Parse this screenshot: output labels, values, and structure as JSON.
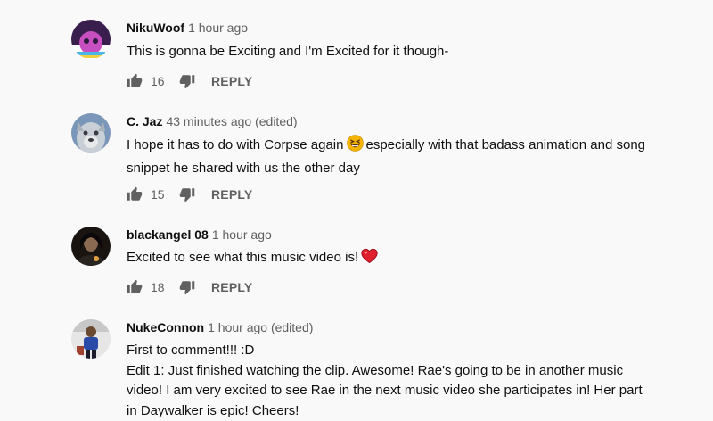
{
  "comments": [
    {
      "author": "NikuWoof",
      "time": "1 hour ago",
      "text": [
        "This is gonna be Exciting and I'm Excited for it though-"
      ],
      "likes": "16",
      "reply_label": "REPLY",
      "avatar_colors": [
        "#2a1a3c",
        "#c84fc0",
        "#ffffff"
      ]
    },
    {
      "author": "C. Jaz",
      "time": "43 minutes ago (edited)",
      "text_before_emoji": "I hope it has to do with Corpse again",
      "emoji": "grinning-squinting-face",
      "text_after_emoji": "especially with that badass animation and song",
      "text_line2": "snippet he shared with us the other day",
      "likes": "15",
      "reply_label": "REPLY",
      "avatar_colors": [
        "#7a96b8",
        "#c9cfd6",
        "#3a3a40"
      ]
    },
    {
      "author": "blackangel 08",
      "time": "1 hour ago",
      "text_before_emoji": "Excited to see what this music video is!",
      "emoji": "red-heart",
      "likes": "18",
      "reply_label": "REPLY",
      "avatar_colors": [
        "#1a1410",
        "#8a6a50",
        "#e0a040"
      ]
    },
    {
      "author": "NukeConnon",
      "time": "1 hour ago (edited)",
      "text": [
        "First to comment!!! :D",
        "Edit 1: Just finished watching the clip. Awesome! Rae's going to be in another music",
        "video! I am very excited to see Rae in the next music video she participates in! Her part",
        "in Daywalker is epic! Cheers!"
      ],
      "avatar_colors": [
        "#e6e6e6",
        "#2a4aa8",
        "#6a4a30"
      ]
    }
  ]
}
